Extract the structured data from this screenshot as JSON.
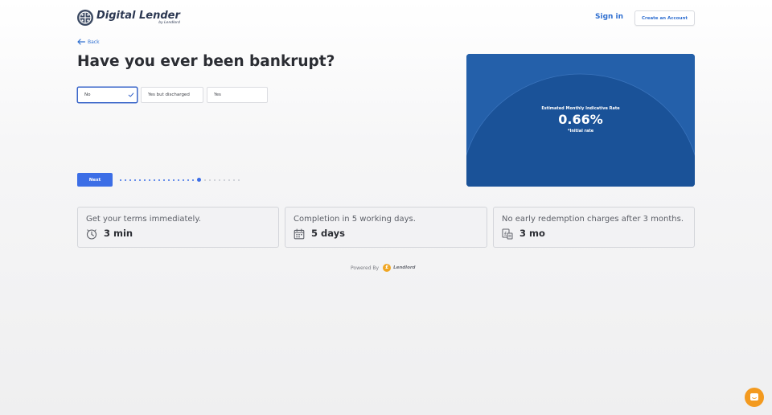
{
  "header": {
    "brand_name": "Digital Lender",
    "brand_sub": "by Lendlord",
    "signin_label": "Sign in",
    "create_account_label": "Create an Account"
  },
  "nav": {
    "back_label": "Back"
  },
  "question": {
    "title": "Have you ever been bankrupt?",
    "options": [
      {
        "label": "No",
        "selected": true
      },
      {
        "label": "Yes but discharged",
        "selected": false
      },
      {
        "label": "Yes",
        "selected": false
      }
    ],
    "next_label": "Next"
  },
  "progress": {
    "total_steps": 25,
    "current_step": 17,
    "completed_color": "#3c6ee6",
    "pending_color": "#c5c8d0"
  },
  "rate_panel": {
    "label": "Estimated Monthly Indicative Rate",
    "value": "0.66%",
    "note": "*Initial rate",
    "accent_color": "#1c569f"
  },
  "features": [
    {
      "title": "Get your terms immediately.",
      "value": "3 min",
      "icon": "timer-icon"
    },
    {
      "title": "Completion in 5 working days.",
      "value": "5 days",
      "icon": "calendar-icon"
    },
    {
      "title": "No early redemption charges after 3 months.",
      "value": "3 mo",
      "icon": "pound-document-icon"
    }
  ],
  "footer": {
    "powered_by_label": "Powered By",
    "powered_by_brand": "Lendlord"
  },
  "colors": {
    "primary": "#3c6ee6",
    "link": "#2f6fd0",
    "chat": "#f39a1f"
  }
}
